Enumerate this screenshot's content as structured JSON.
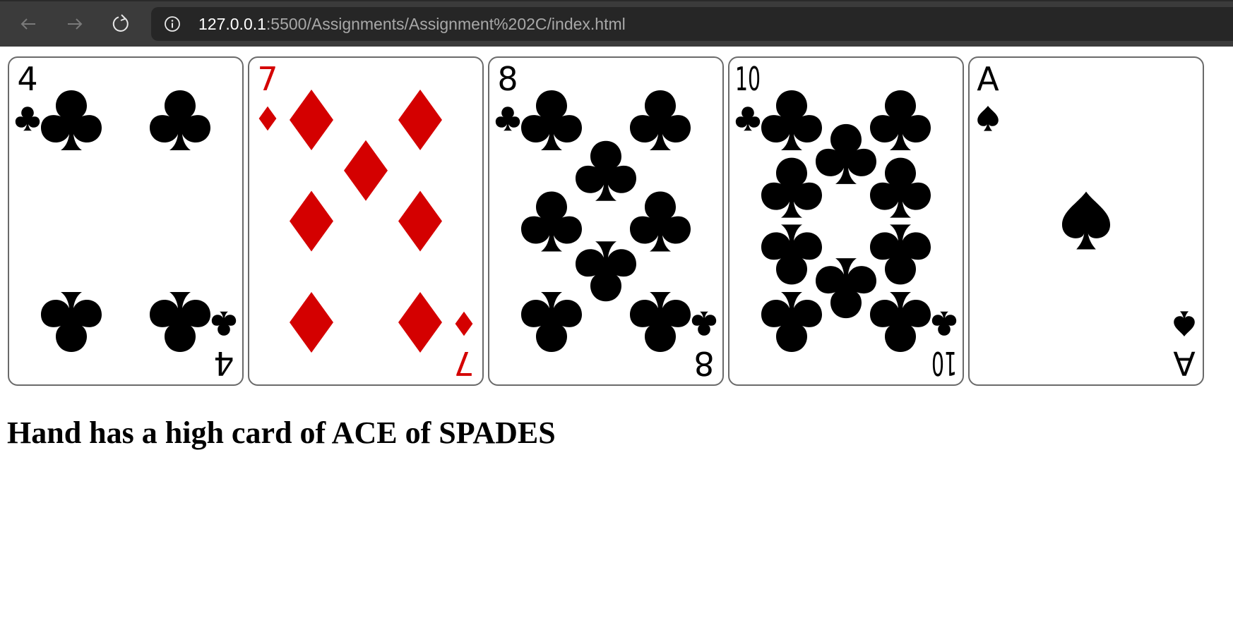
{
  "browser": {
    "url_host": "127.0.0.1",
    "url_path": ":5500/Assignments/Assignment%202C/index.html",
    "icons": [
      "back-arrow-icon",
      "forward-arrow-icon",
      "reload-icon",
      "info-icon"
    ]
  },
  "hand": {
    "cards": [
      {
        "rank": "4",
        "suit": "clubs",
        "color": "#000000"
      },
      {
        "rank": "7",
        "suit": "diamonds",
        "color": "#d40000"
      },
      {
        "rank": "8",
        "suit": "clubs",
        "color": "#000000"
      },
      {
        "rank": "10",
        "suit": "clubs",
        "color": "#000000"
      },
      {
        "rank": "A",
        "suit": "spades",
        "color": "#000000"
      }
    ]
  },
  "result": {
    "text": "Hand has a high card of ACE of SPADES"
  }
}
